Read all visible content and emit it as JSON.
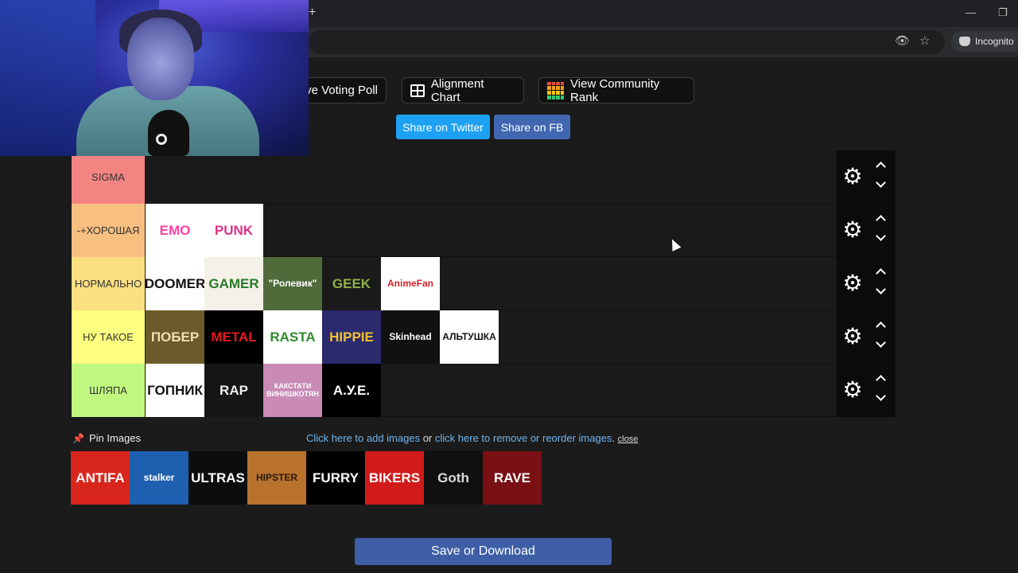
{
  "browser": {
    "new_tab_symbol": "+",
    "incognito_label": "Incognito"
  },
  "toolbar": {
    "voting_poll_label": "ve Voting Poll",
    "alignment_chart_label": "Alignment Chart",
    "community_rank_label": "View Community Rank",
    "share_twitter_label": "Share on Twitter",
    "share_fb_label": "Share on FB",
    "twitter_color": "#1da1f2",
    "fb_color": "#4267b2"
  },
  "tiers": [
    {
      "label": "SIGMA",
      "color": "#f28582",
      "items": []
    },
    {
      "label": "-+ХОРОШАЯ",
      "color": "#f7bf80",
      "items": [
        {
          "name": "emo",
          "text": "EMO",
          "bg": "#ffffff",
          "fg": "#ff3fa6"
        },
        {
          "name": "punk",
          "text": "PUNK",
          "bg": "#ffffff",
          "fg": "#e0308c"
        }
      ]
    },
    {
      "label": "НОРМАЛЬНО",
      "color": "#fbdf80",
      "items": [
        {
          "name": "doomer",
          "text": "DOOMER",
          "bg": "#ffffff",
          "fg": "#111111"
        },
        {
          "name": "gamer",
          "text": "GAMER",
          "bg": "#f3f1e8",
          "fg": "#2a7a2a"
        },
        {
          "name": "rolevik",
          "text": "\"Ролевик\"",
          "bg": "#4f6b3a",
          "fg": "#ffffff"
        },
        {
          "name": "geek",
          "text": "GEEK",
          "bg": "#1a1a1a",
          "fg": "#8fb24a"
        },
        {
          "name": "animefan",
          "text": "AnimeFan",
          "bg": "#ffffff",
          "fg": "#d3232a"
        }
      ]
    },
    {
      "label": "НУ ТАКОЕ",
      "color": "#fdfd7f",
      "items": [
        {
          "name": "pober",
          "text": "ПОБЕР",
          "bg": "#6d5a2b",
          "fg": "#f0e0b0"
        },
        {
          "name": "metal",
          "text": "METAL",
          "bg": "#000000",
          "fg": "#e3191f"
        },
        {
          "name": "rasta",
          "text": "RASTA",
          "bg": "#ffffff",
          "fg": "#2f8a2f"
        },
        {
          "name": "hippie",
          "text": "HIPPIE",
          "bg": "#2b2a6e",
          "fg": "#f2c230"
        },
        {
          "name": "skinhead",
          "text": "Skinhead",
          "bg": "#111111",
          "fg": "#ffffff"
        },
        {
          "name": "altushka",
          "text": "АЛЬТУШКА",
          "bg": "#ffffff",
          "fg": "#111111"
        }
      ]
    },
    {
      "label": "ШЛЯПА",
      "color": "#bff77f",
      "items": [
        {
          "name": "gopnik",
          "text": "ГОПНИК",
          "bg": "#ffffff",
          "fg": "#111111"
        },
        {
          "name": "rap",
          "text": "RAP",
          "bg": "#151515",
          "fg": "#eeeeee"
        },
        {
          "name": "kakstati",
          "text": "КАКСТАТИ ВИНИШКОТЯН",
          "bg": "#c98ab5",
          "fg": "#ffffff"
        },
        {
          "name": "aye",
          "text": "А.У.Е.",
          "bg": "#000000",
          "fg": "#ffffff"
        }
      ]
    }
  ],
  "pin_row": {
    "pin_label": "Pin Images",
    "add_link": "Click here to add images",
    "or_text": "or",
    "remove_link": "click here to remove or reorder images",
    "period": ".",
    "close_label": "close"
  },
  "pool": [
    {
      "name": "antifa",
      "text": "ANTIFA",
      "bg": "#d9261c",
      "fg": "#ffffff"
    },
    {
      "name": "stalker",
      "text": "stalker",
      "bg": "#1f5fb0",
      "fg": "#ffffff"
    },
    {
      "name": "ultras",
      "text": "ULTRAS",
      "bg": "#0d0d0d",
      "fg": "#ffffff"
    },
    {
      "name": "hipster",
      "text": "HIPSTER",
      "bg": "#b8722c",
      "fg": "#2a1a0a"
    },
    {
      "name": "furry",
      "text": "FURRY",
      "bg": "#000000",
      "fg": "#ffffff"
    },
    {
      "name": "bikers",
      "text": "BIKERS",
      "bg": "#d11b1b",
      "fg": "#ffffff"
    },
    {
      "name": "goth",
      "text": "Goth",
      "bg": "#101010",
      "fg": "#dddddd"
    },
    {
      "name": "rave",
      "text": "RAVE",
      "bg": "#7a0f14",
      "fg": "#ffffff"
    }
  ],
  "save_label": "Save or Download"
}
